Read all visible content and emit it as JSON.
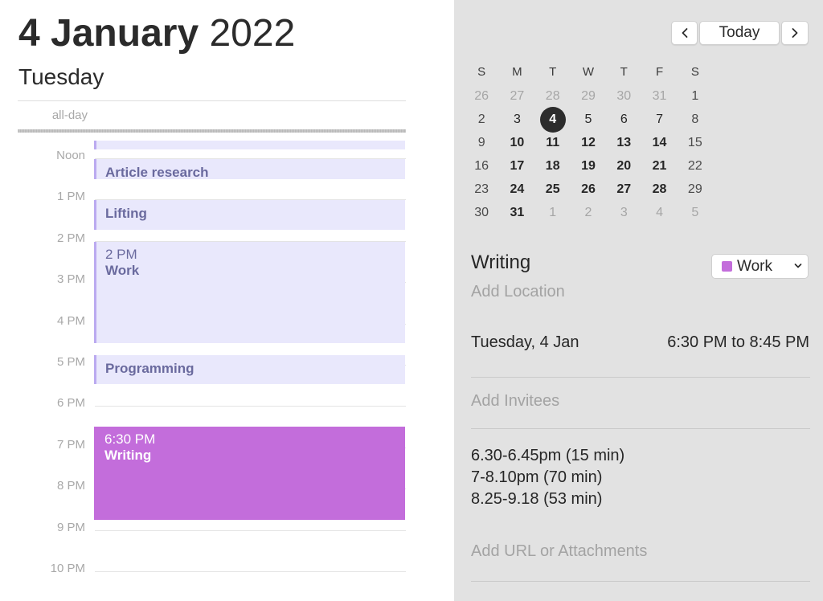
{
  "header": {
    "date_bold": "4 January",
    "year": "2022",
    "weekday": "Tuesday"
  },
  "day_view": {
    "all_day_label": "all-day",
    "hour_labels": [
      "Noon",
      "1 PM",
      "2 PM",
      "3 PM",
      "4 PM",
      "5 PM",
      "6 PM",
      "7 PM",
      "8 PM",
      "9 PM",
      "10 PM"
    ],
    "events": [
      {
        "title": "",
        "time": "",
        "start_hour": 11.55,
        "end_hour": 11.77,
        "selected": false
      },
      {
        "title": "Article research",
        "time": "",
        "start_hour": 12.0,
        "end_hour": 12.48,
        "selected": false
      },
      {
        "title": "Lifting",
        "time": "",
        "start_hour": 13.0,
        "end_hour": 13.72,
        "selected": false
      },
      {
        "title": "Work",
        "time": "2 PM",
        "start_hour": 14.0,
        "end_hour": 16.45,
        "selected": false
      },
      {
        "title": "Programming",
        "time": "",
        "start_hour": 16.75,
        "end_hour": 17.45,
        "selected": false
      },
      {
        "title": "Writing",
        "time": "6:30 PM",
        "start_hour": 18.5,
        "end_hour": 20.75,
        "selected": true
      }
    ]
  },
  "nav": {
    "prev_icon": "chevron-left-icon",
    "today_label": "Today",
    "next_icon": "chevron-right-icon"
  },
  "mini_calendar": {
    "weekday_headers": [
      "S",
      "M",
      "T",
      "W",
      "T",
      "F",
      "S"
    ],
    "weeks": [
      [
        "26",
        "27",
        "28",
        "29",
        "30",
        "31",
        "1"
      ],
      [
        "2",
        "3",
        "4",
        "5",
        "6",
        "7",
        "8"
      ],
      [
        "9",
        "10",
        "11",
        "12",
        "13",
        "14",
        "15"
      ],
      [
        "16",
        "17",
        "18",
        "19",
        "20",
        "21",
        "22"
      ],
      [
        "23",
        "24",
        "25",
        "26",
        "27",
        "28",
        "29"
      ],
      [
        "30",
        "31",
        "1",
        "2",
        "3",
        "4",
        "5"
      ]
    ],
    "selected_day": "4"
  },
  "inspector": {
    "event_title": "Writing",
    "calendar_name": "Work",
    "calendar_color": "#c36ddb",
    "add_location": "Add Location",
    "date": "Tuesday, 4 Jan",
    "time_range": "6:30 PM to 8:45 PM",
    "add_invitees": "Add Invitees",
    "notes": [
      "6.30-6.45pm (15 min)",
      "7-8.10pm (70 min)",
      "8.25-9.18 (53 min)"
    ],
    "add_url": "Add URL or Attachments"
  },
  "colors": {
    "event_bg": "#e9e8fc",
    "event_accent": "#bbaaf0",
    "event_text": "#6a6a9e",
    "selected_event": "#c36ddb"
  }
}
